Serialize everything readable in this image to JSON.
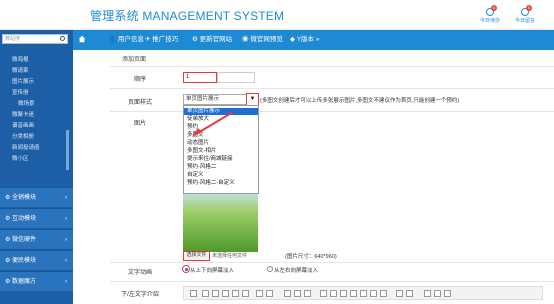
{
  "header": {
    "title": "管理系统 MANAGEMENT SYSTEM",
    "links": [
      {
        "label": "今日待办",
        "badge": "0"
      },
      {
        "label": "今日留言",
        "badge": "0"
      }
    ]
  },
  "sidebar": {
    "search_placeholder": "微站搜",
    "sub_items": [
      "微海报",
      "微请柬",
      "图片展示",
      "宣传册",
      "微场景",
      "微聚卡迷",
      "谱音画画",
      "分类相册",
      "新闻投请函",
      "微小区"
    ],
    "sections": [
      "全销模块",
      "互动模块",
      "微信硬件",
      "便民模块",
      "数据魔方"
    ]
  },
  "nav": {
    "items": [
      "用户信息",
      "推广技巧",
      "更新官网站",
      "微官网预览",
      "Y版本 »"
    ]
  },
  "form": {
    "section_title": "添加页面",
    "order_label": "顺序",
    "order_value": "1",
    "style_label": "页面样式",
    "style_selected": "单页图片展示",
    "style_hint": "(多图文创建后才可以上传多张展示图片,多图文不建议作为首页,只能创建一个预约)",
    "style_options": [
      "单页图片展示",
      "徒弟放大",
      "预约",
      "多图文",
      "动态图片",
      "多图文-相片",
      "提示来往/商城链接",
      "预约-风格二",
      "自定义",
      "预约-风格二-自定义"
    ],
    "image_label": "图片",
    "choose_file": "选择文件",
    "file_status": "未选择任何文件",
    "image_size": "(图片尺寸：640*960)",
    "text_anim_label": "文字动画",
    "anim_option1": "从上下向屏幕淡入",
    "anim_option2": "从左右向屏幕淡入",
    "intro_label": "下/左文字介绍"
  }
}
